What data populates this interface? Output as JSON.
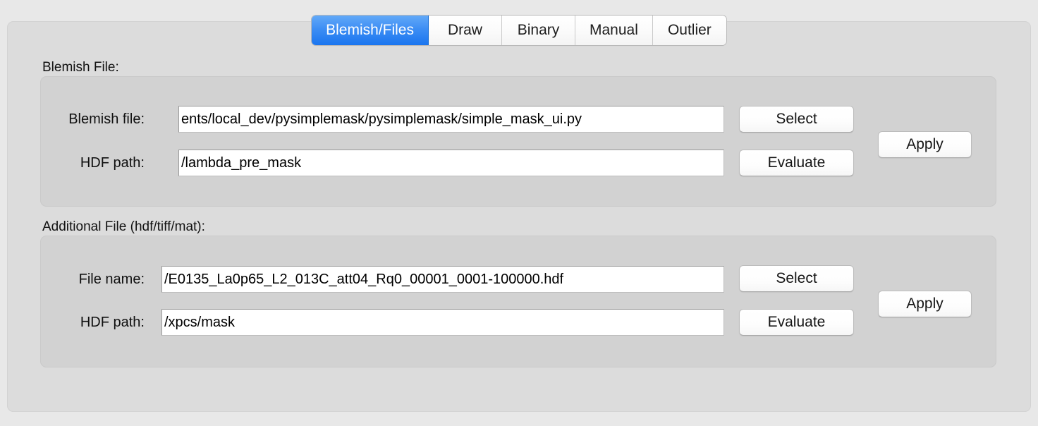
{
  "tabs": [
    {
      "id": "blemish-files",
      "label": "Blemish/Files",
      "active": true
    },
    {
      "id": "draw",
      "label": "Draw",
      "active": false
    },
    {
      "id": "binary",
      "label": "Binary",
      "active": false
    },
    {
      "id": "manual",
      "label": "Manual",
      "active": false
    },
    {
      "id": "outlier",
      "label": "Outlier",
      "active": false
    }
  ],
  "groups": {
    "blemish": {
      "title": "Blemish File:",
      "file_row": {
        "label": "Blemish file:",
        "value": "ents/local_dev/pysimplemask/pysimplemask/simple_mask_ui.py",
        "button": "Select"
      },
      "hdf_row": {
        "label": "HDF path:",
        "value": "/lambda_pre_mask",
        "button": "Evaluate"
      },
      "apply_button": "Apply"
    },
    "additional": {
      "title": "Additional File (hdf/tiff/mat):",
      "file_row": {
        "label": "File name:",
        "value": "/E0135_La0p65_L2_013C_att04_Rq0_00001_0001-100000.hdf",
        "button": "Select"
      },
      "hdf_row": {
        "label": "HDF path:",
        "value": "/xpcs/mask",
        "button": "Evaluate"
      },
      "apply_button": "Apply"
    }
  },
  "colors": {
    "window_background": "#e8e8e8",
    "panel_background": "#dcdcdc",
    "groupbox_background": "#d2d2d2",
    "active_tab_blue": "#1a75ef",
    "active_tab_text": "#ffffff",
    "text": "#101010",
    "input_background": "#ffffff",
    "input_border": "#9a9a9a"
  }
}
